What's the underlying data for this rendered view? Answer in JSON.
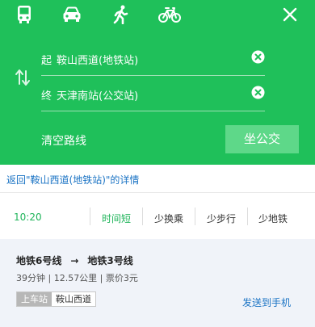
{
  "header": {
    "modes": [
      {
        "name": "transit",
        "icon": "bus-icon",
        "active": true
      },
      {
        "name": "drive",
        "icon": "car-icon",
        "active": false
      },
      {
        "name": "walk",
        "icon": "walk-icon",
        "active": false
      },
      {
        "name": "bike",
        "icon": "bike-icon",
        "active": false
      }
    ],
    "close_icon": "close-icon",
    "swap_icon": "swap-icon",
    "start": {
      "label": "起",
      "value": "鞍山西道(地铁站)"
    },
    "end": {
      "label": "终",
      "value": "天津南站(公交站)"
    },
    "clear_route_label": "清空路线",
    "bus_button_label": "坐公交",
    "colors": {
      "background": "#1fc05a",
      "button": "#5ed889"
    }
  },
  "back_link": "返回\"鞍山西道(地铁站)\"的详情",
  "options": {
    "depart_time": "10:20",
    "items": [
      "时间短",
      "少换乘",
      "少步行",
      "少地铁"
    ],
    "active_index": 0,
    "accent_color": "#1fb45a"
  },
  "route": {
    "line_from": "地铁6号线",
    "arrow": "→",
    "line_to": "地铁3号线",
    "meta": "39分钟 | 12.57公里 | 票价3元",
    "board_tag": "上车站",
    "board_station": "鞍山西道",
    "send_to_phone": "发送到手机"
  }
}
